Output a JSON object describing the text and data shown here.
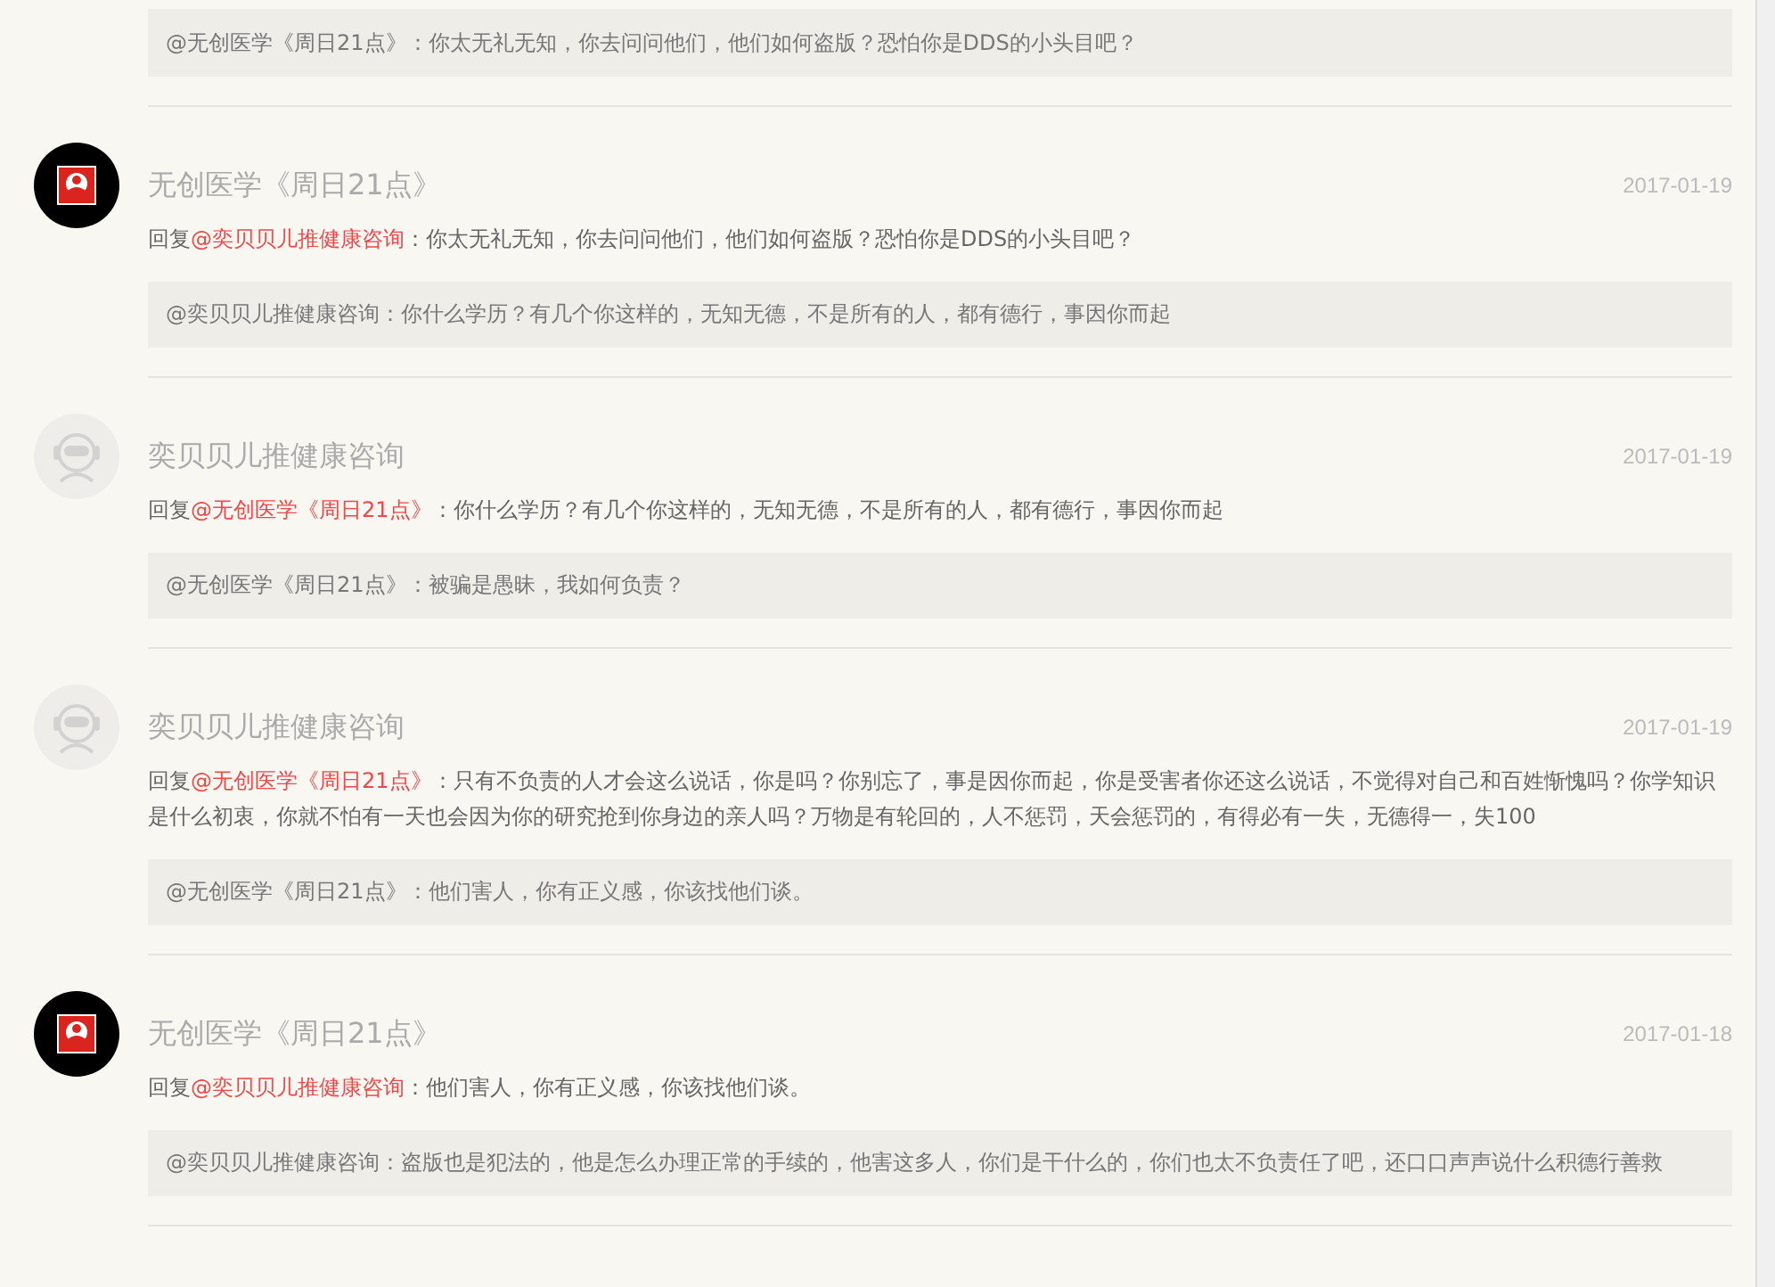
{
  "top_quote": "@无创医学《周日21点》：你太无礼无知，你去问问他们，他们如何盗版？恐怕你是DDS的小头目吧？",
  "comments": [
    {
      "avatar": {
        "kind": "logo"
      },
      "author": "无创医学《周日21点》",
      "date": "2017-01-19",
      "reply": {
        "prefix": "回复",
        "mention": "@奕贝贝儿推健康咨询",
        "text": "：你太无礼无知，你去问问他们，他们如何盗版？恐怕你是DDS的小头目吧？"
      },
      "quote": "@奕贝贝儿推健康咨询：你什么学历？有几个你这样的，无知无德，不是所有的人，都有德行，事因你而起"
    },
    {
      "avatar": {
        "kind": "default"
      },
      "author": "奕贝贝儿推健康咨询",
      "date": "2017-01-19",
      "reply": {
        "prefix": "回复",
        "mention": "@无创医学《周日21点》",
        "text": "：你什么学历？有几个你这样的，无知无德，不是所有的人，都有德行，事因你而起"
      },
      "quote": "@无创医学《周日21点》：被骗是愚昧，我如何负责？"
    },
    {
      "avatar": {
        "kind": "default"
      },
      "author": "奕贝贝儿推健康咨询",
      "date": "2017-01-19",
      "reply": {
        "prefix": "回复",
        "mention": "@无创医学《周日21点》",
        "text": "：只有不负责的人才会这么说话，你是吗？你别忘了，事是因你而起，你是受害者你还这么说话，不觉得对自己和百姓惭愧吗？你学知识是什么初衷，你就不怕有一天也会因为你的研究抢到你身边的亲人吗？万物是有轮回的，人不惩罚，天会惩罚的，有得必有一失，无德得一，失100"
      },
      "quote": "@无创医学《周日21点》：他们害人，你有正义感，你该找他们谈。"
    },
    {
      "avatar": {
        "kind": "logo"
      },
      "author": "无创医学《周日21点》",
      "date": "2017-01-18",
      "reply": {
        "prefix": "回复",
        "mention": "@奕贝贝儿推健康咨询",
        "text": "：他们害人，你有正义感，你该找他们谈。"
      },
      "quote": "@奕贝贝儿推健康咨询：盗版也是犯法的，他是怎么办理正常的手续的，他害这多人，你们是干什么的，你们也太不负责任了吧，还口口声声说什么积德行善救"
    }
  ]
}
